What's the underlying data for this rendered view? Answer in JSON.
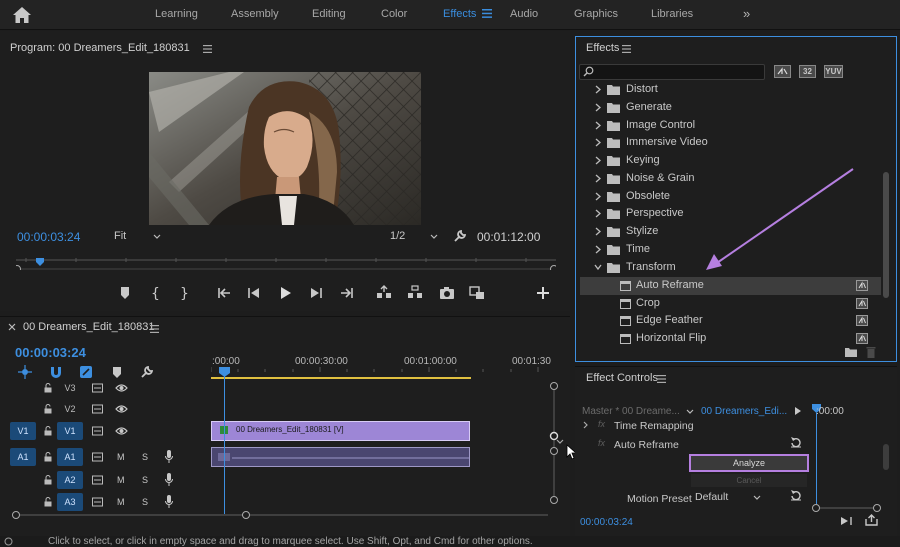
{
  "workspace_tabs": [
    "Learning",
    "Assembly",
    "Editing",
    "Color",
    "Effects",
    "Audio",
    "Graphics",
    "Libraries"
  ],
  "workspace_more": "»",
  "active_workspace": "Effects",
  "program": {
    "title": "Program: 00 Dreamers_Edit_180831",
    "timecode": "00:00:03:24",
    "fit": "Fit",
    "resolution": "1/2",
    "duration": "00:01:12:00"
  },
  "timeline": {
    "title": "00 Dreamers_Edit_180831",
    "timecode": "00:00:03:24",
    "ruler": [
      ":00:00",
      "00:00:30:00",
      "00:01:00:00",
      "00:01:30"
    ],
    "tracks": [
      {
        "name": "V3",
        "target": false,
        "source": ""
      },
      {
        "name": "V2",
        "target": false,
        "source": ""
      },
      {
        "name": "V1",
        "target": true,
        "source": "V1"
      },
      {
        "name": "A1",
        "target": true,
        "source": "A1"
      },
      {
        "name": "A2",
        "target": true,
        "source": ""
      },
      {
        "name": "A3",
        "target": true,
        "source": ""
      }
    ],
    "mute_label": "M",
    "solo_label": "S",
    "clip_v1_label": "00 Dreamers_Edit_180831 [V]"
  },
  "effects": {
    "title": "Effects",
    "search_placeholder": "",
    "badges": [
      "32",
      "YUV"
    ],
    "folders": [
      "Distort",
      "Generate",
      "Image Control",
      "Immersive Video",
      "Keying",
      "Noise & Grain",
      "Obsolete",
      "Perspective",
      "Stylize",
      "Time",
      "Transform"
    ],
    "transform_items": [
      "Auto Reframe",
      "Crop",
      "Edge Feather",
      "Horizontal Flip"
    ],
    "selected_item": "Auto Reframe",
    "annotation_color": "#b57fe0"
  },
  "effect_controls": {
    "title": "Effect Controls",
    "master": "Master * 00 Dreame...",
    "clip": "00 Dreamers_Edi...",
    "mini_tc": ":00:00",
    "time_remapping": "Time Remapping",
    "auto_reframe": "Auto Reframe",
    "fx_badge": "fx",
    "analyze": "Analyze",
    "cancel": "Cancel",
    "motion_preset_label": "Motion Preset",
    "motion_preset_value": "Default",
    "timecode": "00:00:03:24"
  },
  "status_text": "Click to select, or click in empty space and drag to marquee select. Use Shift, Opt, and Cmd for other options.",
  "accent_color": "#3d8fe0"
}
